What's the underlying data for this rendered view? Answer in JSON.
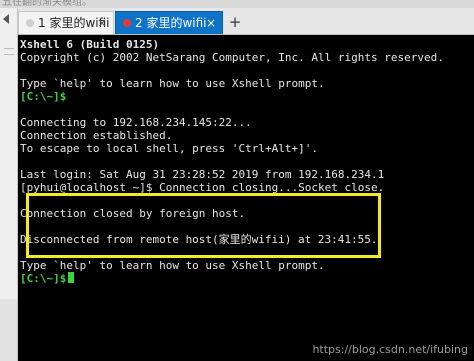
{
  "top_strip_text": "五在翻的渐关模组。",
  "tabs": [
    {
      "label": "1 家里的wifii",
      "dot_color": "#cfcfcf",
      "close": "×",
      "active": false
    },
    {
      "label": "2 家里的wifii",
      "dot_color": "#e53935",
      "close": "×",
      "active": true
    }
  ],
  "new_tab": "+",
  "terminal": {
    "title_line": "Xshell 6 (Build 0125)",
    "copyright_line": "Copyright (c) 2002 NetSarang Computer, Inc. All rights reserved.",
    "help_line_1": "Type `help' to learn how to use Xshell prompt.",
    "prompt_1": "[C:\\~]$",
    "connecting_line": "Connecting to 192.168.234.145:22...",
    "established_line": "Connection established.",
    "escape_line": "To escape to local shell, press 'Ctrl+Alt+]'.",
    "last_login_line": "Last login: Sat Aug 31 23:28:52 2019 from 192.168.234.1",
    "user_line": "[pyhui@localhost ~]$ Connection closing...Socket close.",
    "closed_line": "Connection closed by foreign host.",
    "disconnected_line": "Disconnected from remote host(家里的wifii) at 23:41:55.",
    "help_line_2": "Type `help' to learn how to use Xshell prompt.",
    "prompt_2": "[C:\\~]$"
  },
  "colors": {
    "prompt_green": "#3fd23f",
    "highlight_yellow": "#f2ea24",
    "active_tab_blue": "#0e72c6"
  },
  "watermark": "https://blog.csdn.net/ifubing"
}
